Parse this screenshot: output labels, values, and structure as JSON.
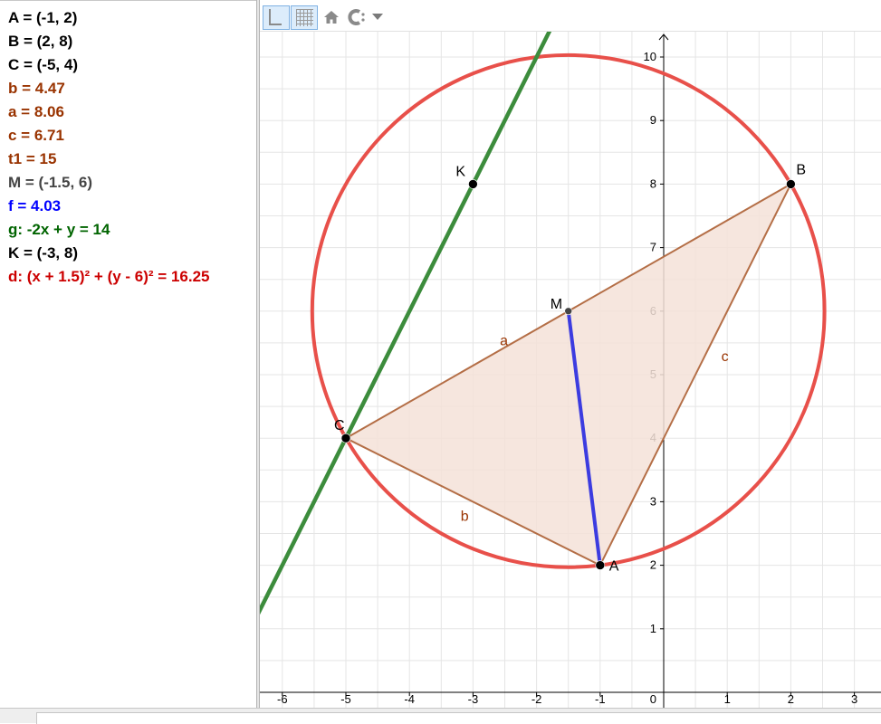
{
  "algebra_view": {
    "items": [
      {
        "text": "A = (-1, 2)",
        "color": "#000000"
      },
      {
        "text": "B = (2, 8)",
        "color": "#000000"
      },
      {
        "text": "C = (-5, 4)",
        "color": "#000000"
      },
      {
        "text": "b = 4.47",
        "color": "#993300"
      },
      {
        "text": "a = 8.06",
        "color": "#993300"
      },
      {
        "text": "c = 6.71",
        "color": "#993300"
      },
      {
        "text": "t1 = 15",
        "color": "#993300"
      },
      {
        "text": "M = (-1.5, 6)",
        "color": "#444444"
      },
      {
        "text": "f = 4.03",
        "color": "#0000ff"
      },
      {
        "text": "g: -2x + y = 14",
        "color": "#006400"
      },
      {
        "text": "K = (-3, 8)",
        "color": "#000000"
      },
      {
        "text": "d: (x + 1.5)² + (y - 6)² = 16.25",
        "color": "#cc0000"
      }
    ]
  },
  "toolbar": {
    "buttons": [
      {
        "name": "toggle-axes-button",
        "icon": "axes-icon"
      },
      {
        "name": "toggle-grid-button",
        "icon": "grid-icon"
      },
      {
        "name": "standard-view-button",
        "icon": "home-icon"
      },
      {
        "name": "point-capturing-button",
        "icon": "capture-icon"
      },
      {
        "name": "point-capturing-dropdown",
        "icon": "triangle-down-icon"
      }
    ]
  },
  "graphics_view": {
    "x_range": [
      -6.3,
      3.45
    ],
    "y_range": [
      0,
      10.35
    ],
    "x_ticks": [
      "-6",
      "-5",
      "-4",
      "-3",
      "-2",
      "-1",
      "1",
      "2",
      "3"
    ],
    "y_ticks": [
      "1",
      "2",
      "3",
      "4",
      "5",
      "6",
      "7",
      "8",
      "9",
      "10"
    ],
    "origin_label": "0",
    "grid": true,
    "points": [
      {
        "id": "A",
        "label": "A",
        "x": -1,
        "y": 2
      },
      {
        "id": "B",
        "label": "B",
        "x": 2,
        "y": 8
      },
      {
        "id": "C",
        "label": "C",
        "x": -5,
        "y": 4
      },
      {
        "id": "M",
        "label": "M",
        "x": -1.5,
        "y": 6
      },
      {
        "id": "K",
        "label": "K",
        "x": -3,
        "y": 8
      }
    ],
    "segment_labels": [
      {
        "id": "a",
        "label": "a"
      },
      {
        "id": "b",
        "label": "b"
      },
      {
        "id": "c",
        "label": "c"
      }
    ],
    "circle": {
      "name": "d",
      "center": [
        -1.5,
        6
      ],
      "radius": 4.03,
      "color": "#e8504a"
    },
    "line": {
      "name": "g",
      "slope": 2,
      "intercept": 14,
      "color": "#3c8c3c"
    },
    "segment_f": {
      "from": "M",
      "to": "A",
      "color": "#3c3ce0"
    },
    "triangle": {
      "name": "t1",
      "vertices": [
        "A",
        "B",
        "C"
      ],
      "stroke": "#b46e46",
      "fill": "#f5e2d8"
    },
    "colors": {
      "grid": "#e5e5e5",
      "axis": "#000000",
      "tick_label": "#000000",
      "segment_label": "#993300"
    }
  },
  "input_bar": {
    "value": ""
  }
}
